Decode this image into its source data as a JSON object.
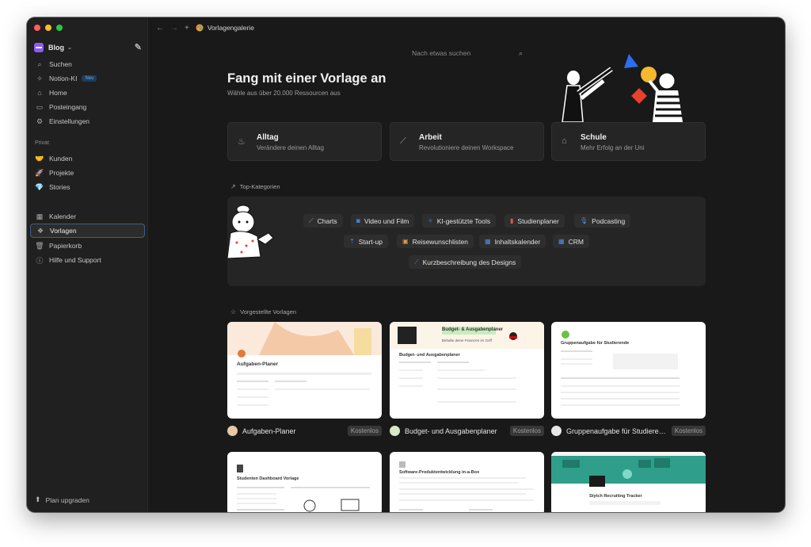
{
  "sidebar": {
    "workspace": "Blog",
    "nav": [
      {
        "label": "Suchen",
        "icon": "search-icon"
      },
      {
        "label": "Notion-KI",
        "icon": "sparkle-icon",
        "badge": "Neu"
      },
      {
        "label": "Home",
        "icon": "home-icon"
      },
      {
        "label": "Posteingang",
        "icon": "inbox-icon"
      },
      {
        "label": "Einstellungen",
        "icon": "gear-icon"
      }
    ],
    "private_label": "Privat",
    "private": [
      {
        "label": "Kunden",
        "icon": "handshake-icon"
      },
      {
        "label": "Projekte",
        "icon": "rocket-icon"
      },
      {
        "label": "Stories",
        "icon": "diamond-icon"
      }
    ],
    "tools": [
      {
        "label": "Kalender",
        "icon": "calendar-icon"
      },
      {
        "label": "Vorlagen",
        "icon": "templates-icon"
      },
      {
        "label": "Papierkorb",
        "icon": "trash-icon"
      },
      {
        "label": "Hilfe und Support",
        "icon": "help-icon"
      }
    ],
    "upgrade": "Plan upgraden"
  },
  "topbar": {
    "title": "Vorlagengalerie"
  },
  "search": {
    "placeholder": "Nach etwas suchen"
  },
  "hero": {
    "title": "Fang mit einer Vorlage an",
    "subtitle": "Wähle aus über 20.000 Ressourcen aus"
  },
  "categories": [
    {
      "title": "Alltag",
      "subtitle": "Verändere deinen Alltag",
      "icon": "plant-icon"
    },
    {
      "title": "Arbeit",
      "subtitle": "Revolutioniere deinen Workspace",
      "icon": "chart-line-icon"
    },
    {
      "title": "Schule",
      "subtitle": "Mehr Erfolg an der Uni",
      "icon": "school-icon"
    }
  ],
  "top_categories": {
    "label": "Top-Kategorien",
    "chips": [
      {
        "label": "Charts",
        "color": "#9aa0a6"
      },
      {
        "label": "Video und Film",
        "color": "#4d8fe0"
      },
      {
        "label": "KI-gestützte Tools",
        "color": "#4d8fe0"
      },
      {
        "label": "Studienplaner",
        "color": "#e05252"
      },
      {
        "label": "Podcasting",
        "color": "#4d8fe0"
      },
      {
        "label": "Start-up",
        "color": "#4d8fe0"
      },
      {
        "label": "Reisewunschlisten",
        "color": "#e0a030"
      },
      {
        "label": "Inhaltskalender",
        "color": "#4d8fe0"
      },
      {
        "label": "CRM",
        "color": "#4d8fe0"
      },
      {
        "label": "Kurzbeschreibung des Designs",
        "color": "#4d8fe0"
      }
    ]
  },
  "featured": {
    "label": "Vorgestellte Vorlagen",
    "free_label": "Kostenlos",
    "templates": [
      {
        "name": "Aufgaben-Planer",
        "preview_title": "Aufgaben-Planer"
      },
      {
        "name": "Budget- und Ausgabenplaner",
        "preview_title": "Budget- und Ausgabenplaner",
        "preview_banner": "Budget- & Ausgabenplaner",
        "preview_tagline": "Behalte deine Finanzen im Griff"
      },
      {
        "name": "Gruppenaufgabe für Studierende",
        "preview_title": "Gruppenaufgabe für Studierende"
      }
    ],
    "templates_row2": [
      {
        "preview_title": "Studenten Dashboard Vorlage"
      },
      {
        "preview_title": "Software-Produktentwicklung in-a-Box"
      },
      {
        "preview_title": "Stytch Recruiting Tracker"
      }
    ]
  },
  "colors": {
    "accent": "#3d5f86",
    "badge_bg": "#1f3d5c",
    "badge_fg": "#72a8de"
  }
}
